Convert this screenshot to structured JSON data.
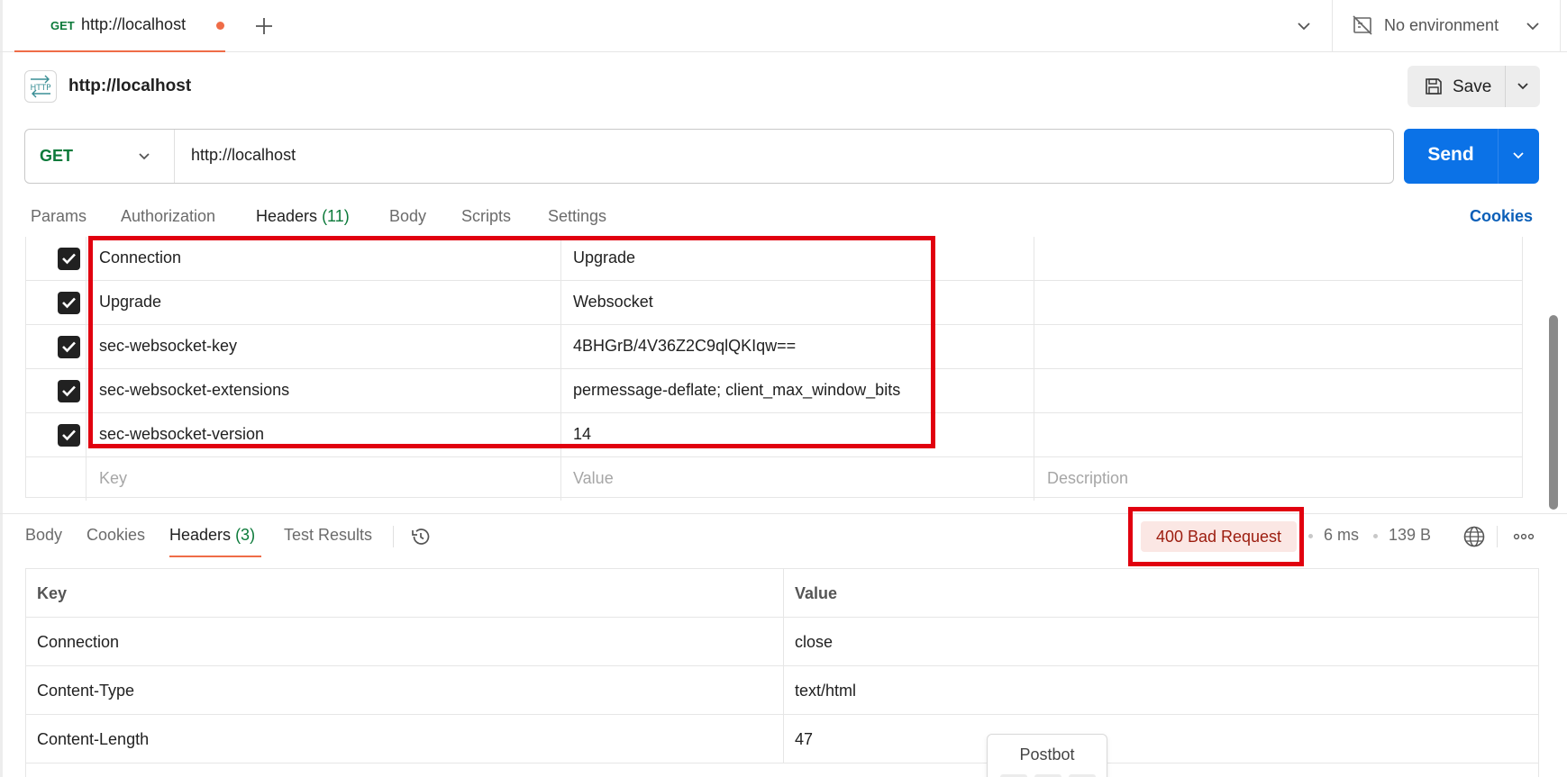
{
  "tabbar": {
    "active_tab": {
      "method": "GET",
      "title": "http://localhost"
    },
    "environment": "No environment"
  },
  "request": {
    "name": "http://localhost",
    "icon_text": "HTTP",
    "save_label": "Save",
    "method": "GET",
    "url": "http://localhost",
    "send_label": "Send"
  },
  "request_tabs": {
    "params": "Params",
    "authorization": "Authorization",
    "headers": "Headers",
    "headers_count": "(11)",
    "body": "Body",
    "scripts": "Scripts",
    "settings": "Settings",
    "cookies": "Cookies"
  },
  "headers_table": {
    "rows": [
      {
        "key": "Connection",
        "value": "Upgrade",
        "description": ""
      },
      {
        "key": "Upgrade",
        "value": "Websocket",
        "description": ""
      },
      {
        "key": "sec-websocket-key",
        "value": "4BHGrB/4V36Z2C9qlQKIqw==",
        "description": ""
      },
      {
        "key": "sec-websocket-extensions",
        "value": "permessage-deflate; client_max_window_bits",
        "description": ""
      },
      {
        "key": "sec-websocket-version",
        "value": "14",
        "description": ""
      }
    ],
    "placeholder": {
      "key": "Key",
      "value": "Value",
      "description": "Description"
    }
  },
  "response_tabs": {
    "body": "Body",
    "cookies": "Cookies",
    "headers": "Headers",
    "headers_count": "(3)",
    "test_results": "Test Results"
  },
  "response_meta": {
    "status": "400 Bad Request",
    "time": "6 ms",
    "size": "139 B"
  },
  "response_headers": {
    "columns": {
      "key": "Key",
      "value": "Value"
    },
    "rows": [
      {
        "key": "Connection",
        "value": "close"
      },
      {
        "key": "Content-Type",
        "value": "text/html"
      },
      {
        "key": "Content-Length",
        "value": "47"
      }
    ]
  },
  "postbot": {
    "label": "Postbot"
  },
  "colors": {
    "get_method": "#0c7a3a",
    "send_button": "#0b72e7",
    "accent_orange": "#ef6c47",
    "status_error_text": "#9c1c0e",
    "status_error_bg": "#fbe7e4",
    "annotation_red": "#e1000f"
  },
  "icons": [
    "plus-icon",
    "chevron-down-icon",
    "no-environment-icon",
    "http-icon",
    "save-icon",
    "checkbox-checked-icon",
    "history-icon",
    "globe-icon",
    "more-icon"
  ]
}
